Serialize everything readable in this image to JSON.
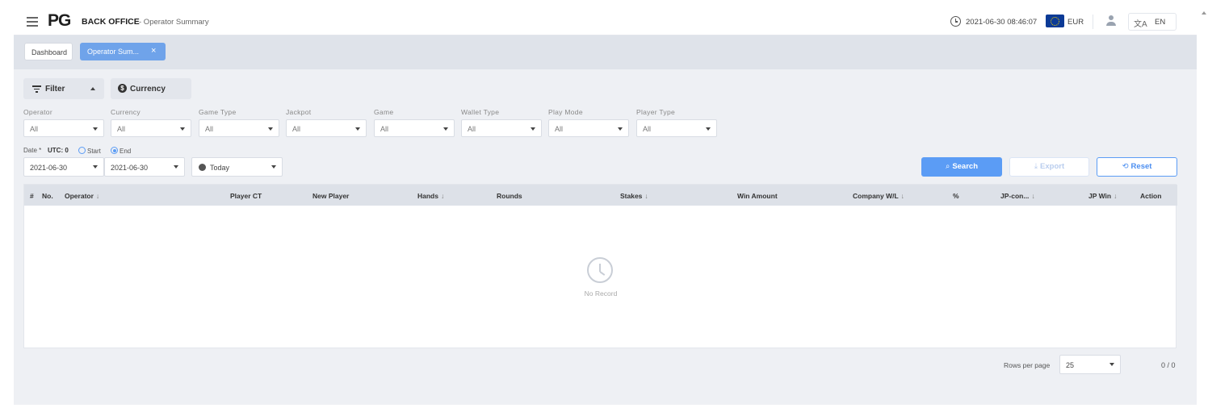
{
  "header": {
    "logo": "PG",
    "app_name": "BACK OFFICE",
    "page_name": "- Operator Summary",
    "datetime": "2021-06-30 08:46:07",
    "currency": "EUR",
    "language": "EN",
    "lang_glyph": "文A"
  },
  "tabs": [
    {
      "label": "Dashboard"
    },
    {
      "label": "Operator Sum...",
      "close": "×"
    }
  ],
  "filter_bar": {
    "filter_label": "Filter",
    "currency_label": "Currency",
    "currency_symbol": "$"
  },
  "filters": [
    {
      "label": "Operator",
      "value": "All"
    },
    {
      "label": "Currency",
      "value": "All"
    },
    {
      "label": "Game Type",
      "value": "All"
    },
    {
      "label": "Jackpot",
      "value": "All"
    },
    {
      "label": "Game",
      "value": "All"
    },
    {
      "label": "Wallet Type",
      "value": "All"
    },
    {
      "label": "Play Mode",
      "value": "All"
    },
    {
      "label": "Player Type",
      "value": "All"
    }
  ],
  "date": {
    "label": "Date *",
    "utc": "UTC: 0",
    "start_label": "Start",
    "end_label": "End",
    "from": "2021-06-30",
    "to": "2021-06-30",
    "range": "Today"
  },
  "actions": {
    "search": "Search",
    "export": "Export",
    "reset": "Reset"
  },
  "table": {
    "columns": [
      {
        "label": "#"
      },
      {
        "label": "No."
      },
      {
        "label": "Operator",
        "sort": "↓"
      },
      {
        "label": "Player CT"
      },
      {
        "label": "New Player"
      },
      {
        "label": "Hands",
        "sort": "↓"
      },
      {
        "label": "Rounds"
      },
      {
        "label": "Stakes",
        "sort": "↓"
      },
      {
        "label": "Win Amount"
      },
      {
        "label": "Company W/L",
        "sort": "↓"
      },
      {
        "label": "%"
      },
      {
        "label": "JP-con...",
        "sort": "↓"
      },
      {
        "label": "JP Win",
        "sort": "↓"
      },
      {
        "label": "Action"
      }
    ],
    "empty_text": "No Record"
  },
  "pagination": {
    "rows_per_page_label": "Rows per page",
    "rows_per_page": "25",
    "count": "0 / 0"
  }
}
